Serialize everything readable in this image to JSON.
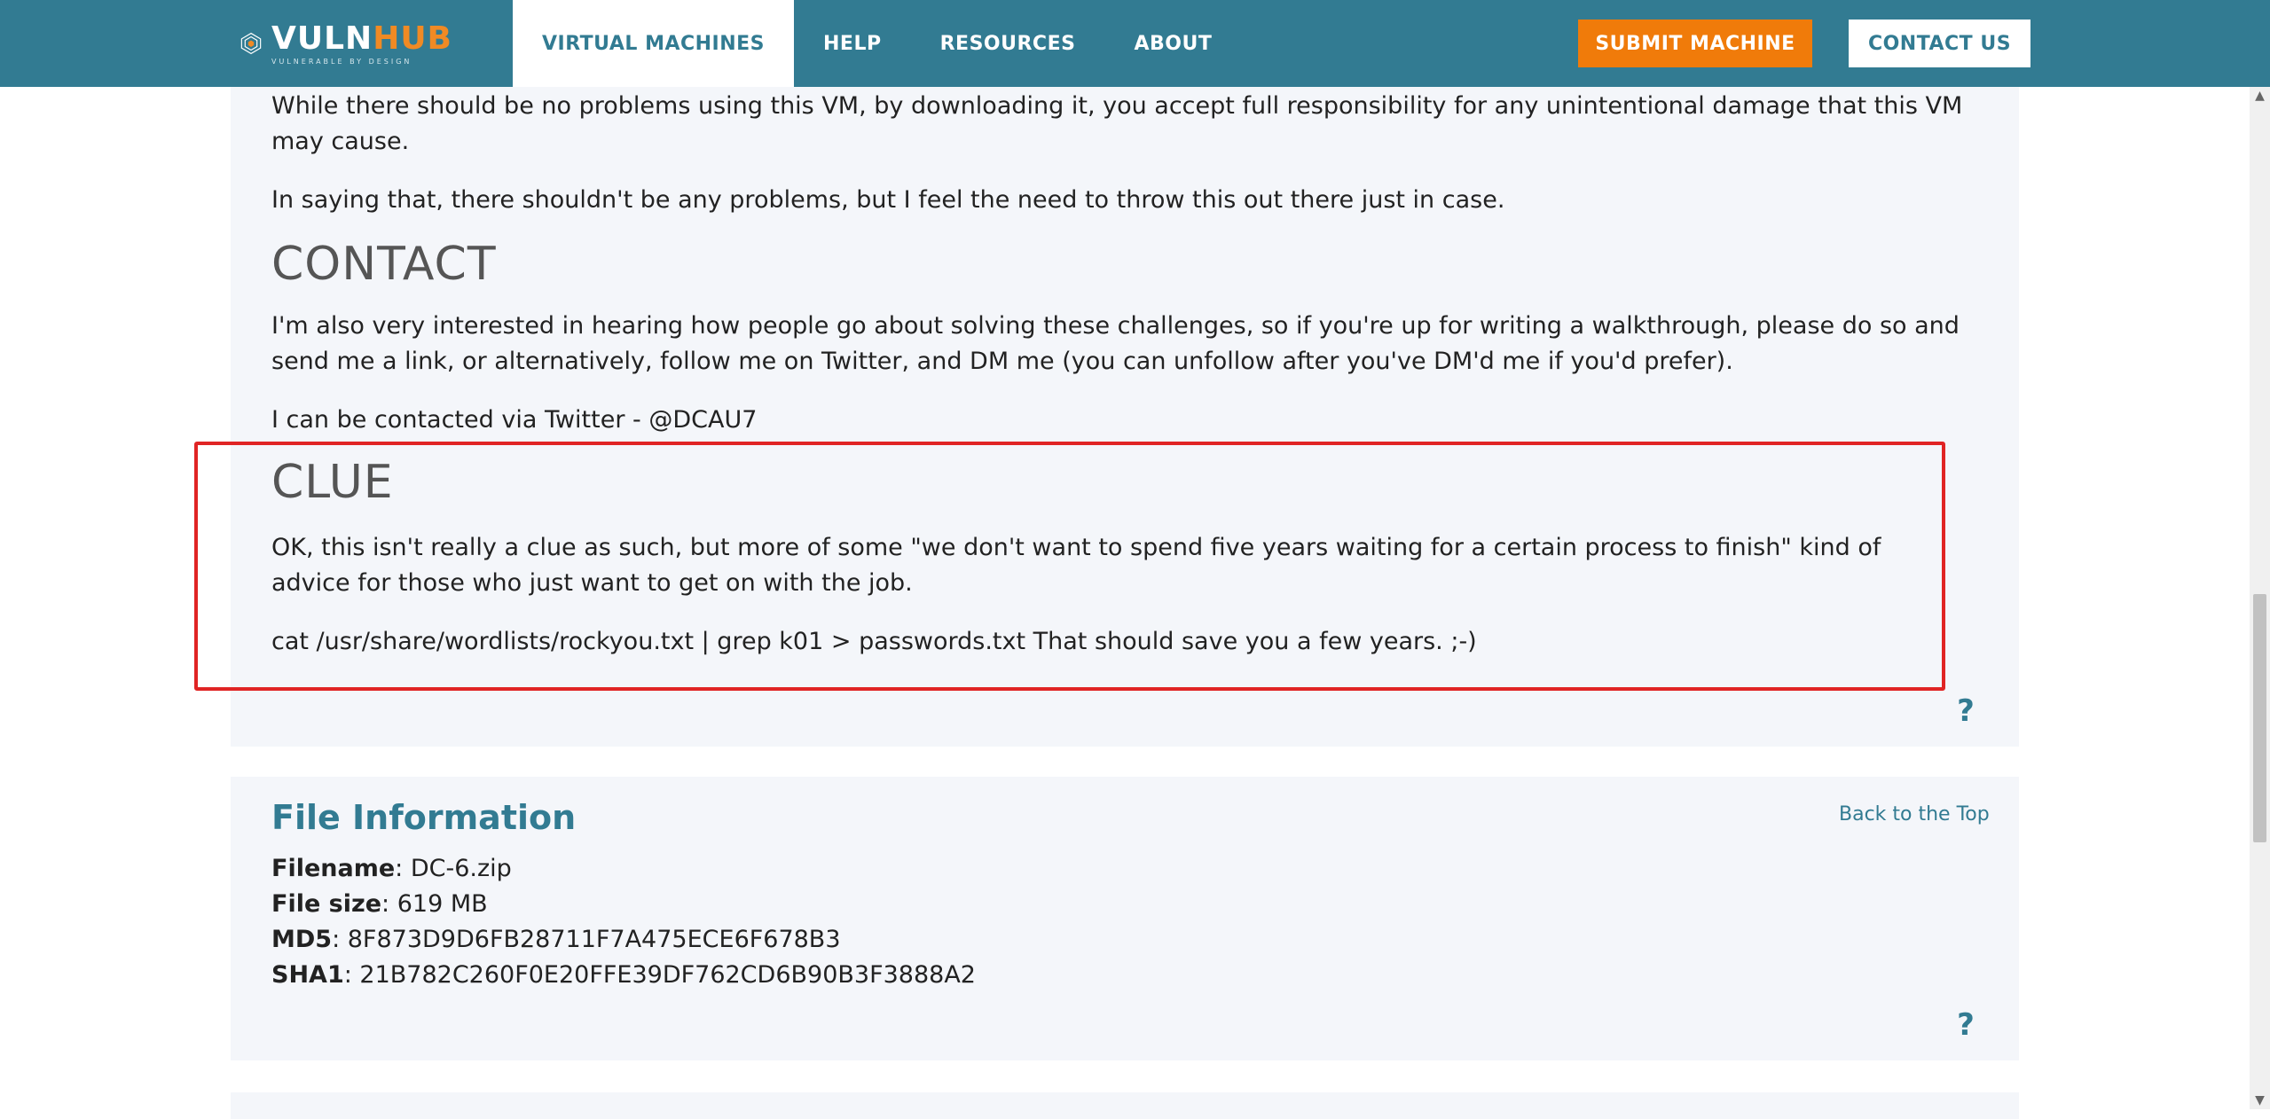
{
  "nav": {
    "logo_word_main": "VULN",
    "logo_word_accent": "HUB",
    "logo_tagline": "VULNERABLE BY DESIGN",
    "items": [
      {
        "label": "VIRTUAL MACHINES",
        "active": true
      },
      {
        "label": "HELP"
      },
      {
        "label": "RESOURCES"
      },
      {
        "label": "ABOUT"
      }
    ],
    "submit_label": "SUBMIT MACHINE",
    "contact_label": "CONTACT US"
  },
  "description": {
    "disclaimer_p1": "While there should be no problems using this VM, by downloading it, you accept full responsibility for any unintentional damage that this VM may cause.",
    "disclaimer_p2": "In saying that, there shouldn't be any problems, but I feel the need to throw this out there just in case.",
    "contact_heading": "CONTACT",
    "contact_p1": "I'm also very interested in hearing how people go about solving these challenges, so if you're up for writing a walkthrough, please do so and send me a link, or alternatively, follow me on Twitter, and DM me (you can unfollow after you've DM'd me if you'd prefer).",
    "contact_p2": "I can be contacted via Twitter - @DCAU7",
    "clue_heading": "CLUE",
    "clue_p1": "OK, this isn't really a clue as such, but more of some \"we don't want to spend five years waiting for a certain process to finish\" kind of advice for those who just want to get on with the job.",
    "clue_p2": "cat /usr/share/wordlists/rockyou.txt | grep k01 > passwords.txt That should save you a few years. ;-)",
    "help_symbol": "?"
  },
  "file_info": {
    "title": "File Information",
    "back_to_top": "Back to the Top",
    "filename_label": "Filename",
    "filename_value": ": DC-6.zip",
    "filesize_label": "File size",
    "filesize_value": ": 619 MB",
    "md5_label": "MD5",
    "md5_value": ": 8F873D9D6FB28711F7A475ECE6F678B3",
    "sha1_label": "SHA1",
    "sha1_value": ": 21B782C260F0E20FFE39DF762CD6B90B3F3888A2",
    "help_symbol": "?"
  },
  "colors": {
    "navbar": "#327b92",
    "submit_button": "#f07b0a",
    "highlight_box": "#e02424",
    "panel_bg": "#f4f6fa"
  }
}
